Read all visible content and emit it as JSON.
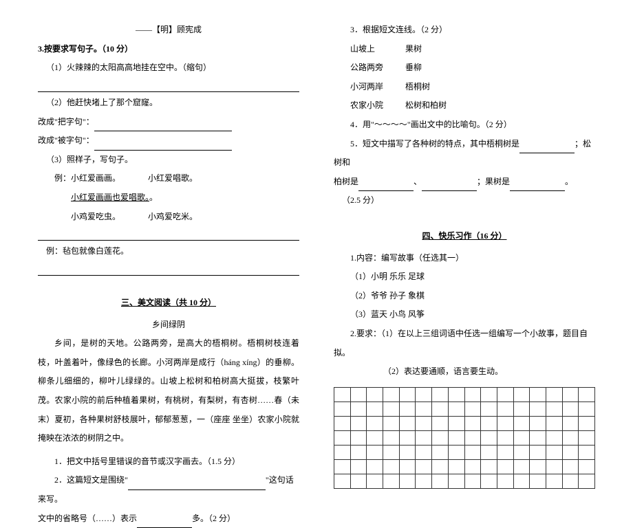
{
  "left": {
    "attribution": "——【明】顾宪成",
    "q3_title": "3.按要求写句子。（10 分）",
    "q3_1": "（1）火辣辣的太阳高高地挂在空中。（缩句）",
    "q3_2": "（2）他赶快堵上了那个窟窿。",
    "q3_2_ba": "改成\"把字句\"：",
    "q3_2_bei": "改成\"被字句\"：",
    "q3_3": "（3）照样子，写句子。",
    "q3_3_ex_label": "例：小红爱画画。",
    "q3_3_ex_label2": "小红爱唱歌。",
    "q3_3_ex_combined": "小红爱画画也爱唱歌。",
    "q3_3_a": "小鸡爱吃虫。",
    "q3_3_b": "小鸡爱吃米。",
    "q3_4_ex": "例：毡包就像白莲花。",
    "section3_title": "三、美文阅读（共 10 分）",
    "passage_title": "乡间绿阴",
    "passage": "乡间，是树的天地。公路两旁，是高大的梧桐树。梧桐树枝连着枝，叶盖着叶，像绿色的长廊。小河两岸是成行（háng  xíng）的垂柳。柳条儿细细的，柳叶儿绿绿的。山坡上松树和柏树高大挺拔，枝繁叶茂。农家小院的前后种植着果树，有桃树，有梨树，有杏树……春（未  末）夏初，各种果树舒枝展叶，郁郁葱葱，一（座座  坐坐）农家小院就掩映在浓浓的树阴之中。",
    "pq1": "1．把文中括号里错误的音节或汉字画去。（1.5 分）",
    "pq2_a": "2．这篇短文是围绕\"",
    "pq2_b": "\"这句话来写。",
    "pq2_c": "文中的省略号（……）表示",
    "pq2_d": "多。（2 分）"
  },
  "right": {
    "pq3": "3．根据短文连线。（2 分）",
    "m1l": "山坡上",
    "m1r": "果树",
    "m2l": "公路两旁",
    "m2r": "垂柳",
    "m3l": "小河两岸",
    "m3r": "梧桐树",
    "m4l": "农家小院",
    "m4r": "松树和柏树",
    "pq4": "4．用\"～～～～\"画出文中的比喻句。（2 分）",
    "pq5_a": "5．短文中描写了各种树的特点，其中梧桐树是",
    "pq5_b": "；松树和",
    "pq5_c": "柏树是",
    "pq5_d": "、",
    "pq5_e": "；果树是",
    "pq5_f": "。",
    "pq5_score": "（2.5 分）",
    "section4_title": "四、快乐习作（16 分）",
    "w1": "1.内容：编写故事（任选其一）",
    "w1_1": "（1）小明     乐乐     足球",
    "w1_2": "（2）爷爷     孙子     象棋",
    "w1_3": "（3）蓝天     小鸟     风筝",
    "w2": "2.要求：（1）在以上三组词语中任选一组编写一个小故事，题目自拟。",
    "w2_2": "（2）表达要通顺，语言要生动。"
  }
}
